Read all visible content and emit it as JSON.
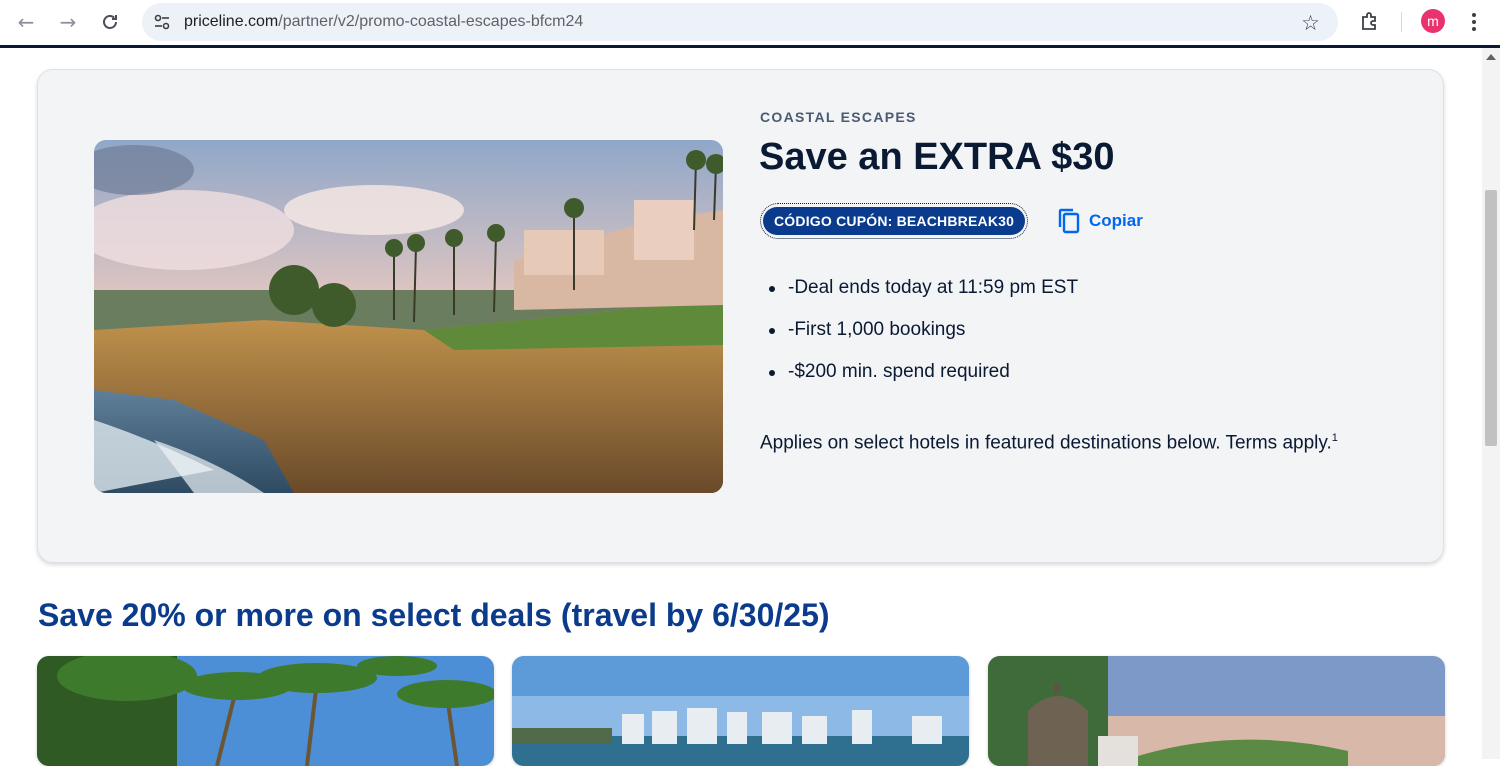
{
  "browser": {
    "url_host": "priceline.com",
    "url_path": "/partner/v2/promo-coastal-escapes-bfcm24",
    "avatar_letter": "m",
    "icons": [
      "back-arrow-icon",
      "forward-arrow-icon",
      "reload-icon",
      "site-settings-icon",
      "star-icon",
      "extensions-icon",
      "kebab-menu-icon"
    ]
  },
  "promo": {
    "eyebrow": "COASTAL ESCAPES",
    "headline": "Save an EXTRA $30",
    "coupon_label": "CÓDIGO CUPÓN: BEACHBREAK30",
    "copy_label": "Copiar",
    "bullets": [
      "-Deal ends today at 11:59 pm EST",
      "-First 1,000 bookings",
      "-$200 min. spend required"
    ],
    "terms_text": "Applies on select hotels in featured destinations below. Terms apply.",
    "terms_footnote": "1"
  },
  "deals": {
    "section_title": "Save 20% or more on select deals (travel by 6/30/25)"
  },
  "colors": {
    "brand_blue": "#0a3b8c",
    "link_blue": "#0068ef",
    "ink": "#0b1a33",
    "card_bg": "#f3f4f6"
  }
}
